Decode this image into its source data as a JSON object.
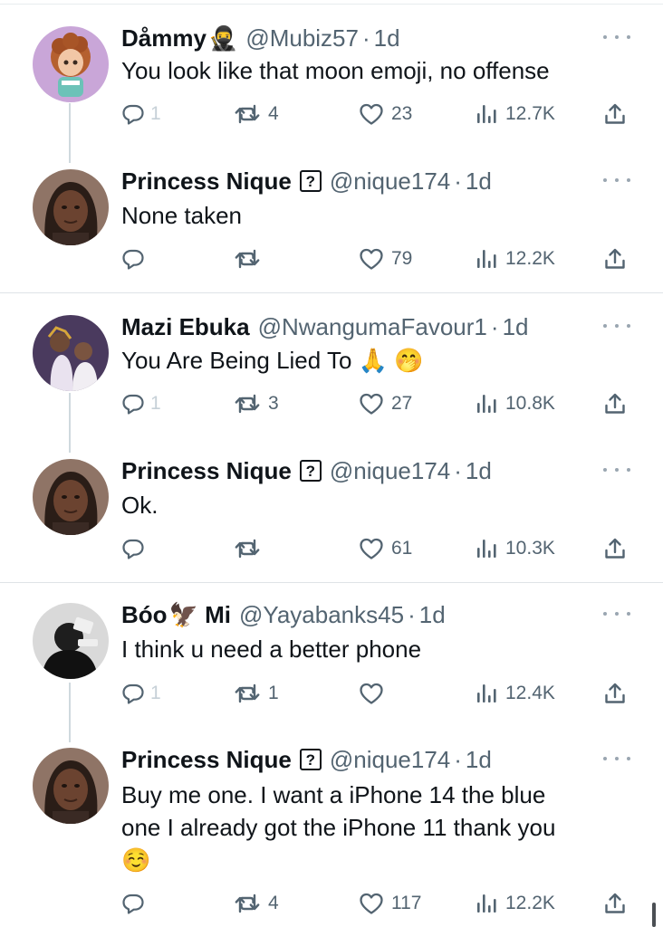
{
  "colors": {
    "text": "#0f1419",
    "secondary": "#536471",
    "divider": "#dfe3e7",
    "thread": "#cfd9de"
  },
  "tweets": [
    {
      "name": "Dåmmy",
      "name_suffix": "🥷",
      "handle": "@Mubiz57",
      "time": "1d",
      "text": "You look like that moon emoji, no offense",
      "reply_count": "1",
      "retweet_count": "4",
      "like_count": "23",
      "view_count": "12.7K"
    },
    {
      "name": "Princess Nique",
      "badge": "?",
      "handle": "@nique174",
      "time": "1d",
      "text": "None taken",
      "reply_count": "",
      "retweet_count": "",
      "like_count": "79",
      "view_count": "12.2K"
    },
    {
      "name": "Mazi Ebuka",
      "handle": "@NwangumaFavour1",
      "time": "1d",
      "text": "You Are Being Lied To 🙏 🤭",
      "reply_count": "1",
      "retweet_count": "3",
      "like_count": "27",
      "view_count": "10.8K"
    },
    {
      "name": "Princess Nique",
      "badge": "?",
      "handle": "@nique174",
      "time": "1d",
      "text": "Ok.",
      "reply_count": "",
      "retweet_count": "",
      "like_count": "61",
      "view_count": "10.3K"
    },
    {
      "name": "Bóo",
      "name_suffix": "🦅 Mi",
      "handle": "@Yayabanks45",
      "time": "1d",
      "text": "I think u need a better phone",
      "reply_count": "1",
      "retweet_count": "1",
      "like_count": "",
      "view_count": "12.4K"
    },
    {
      "name": "Princess Nique",
      "badge": "?",
      "handle": "@nique174",
      "time": "1d",
      "text": "Buy me one. I want a iPhone 14 the blue\none I already got the iPhone 11 thank you\n☺️",
      "reply_count": "",
      "retweet_count": "4",
      "like_count": "117",
      "view_count": "12.2K"
    }
  ],
  "icons": {
    "reply": "reply-icon",
    "retweet": "retweet-icon",
    "like": "heart-icon",
    "views": "views-icon",
    "share": "share-icon",
    "more": "more-icon"
  }
}
